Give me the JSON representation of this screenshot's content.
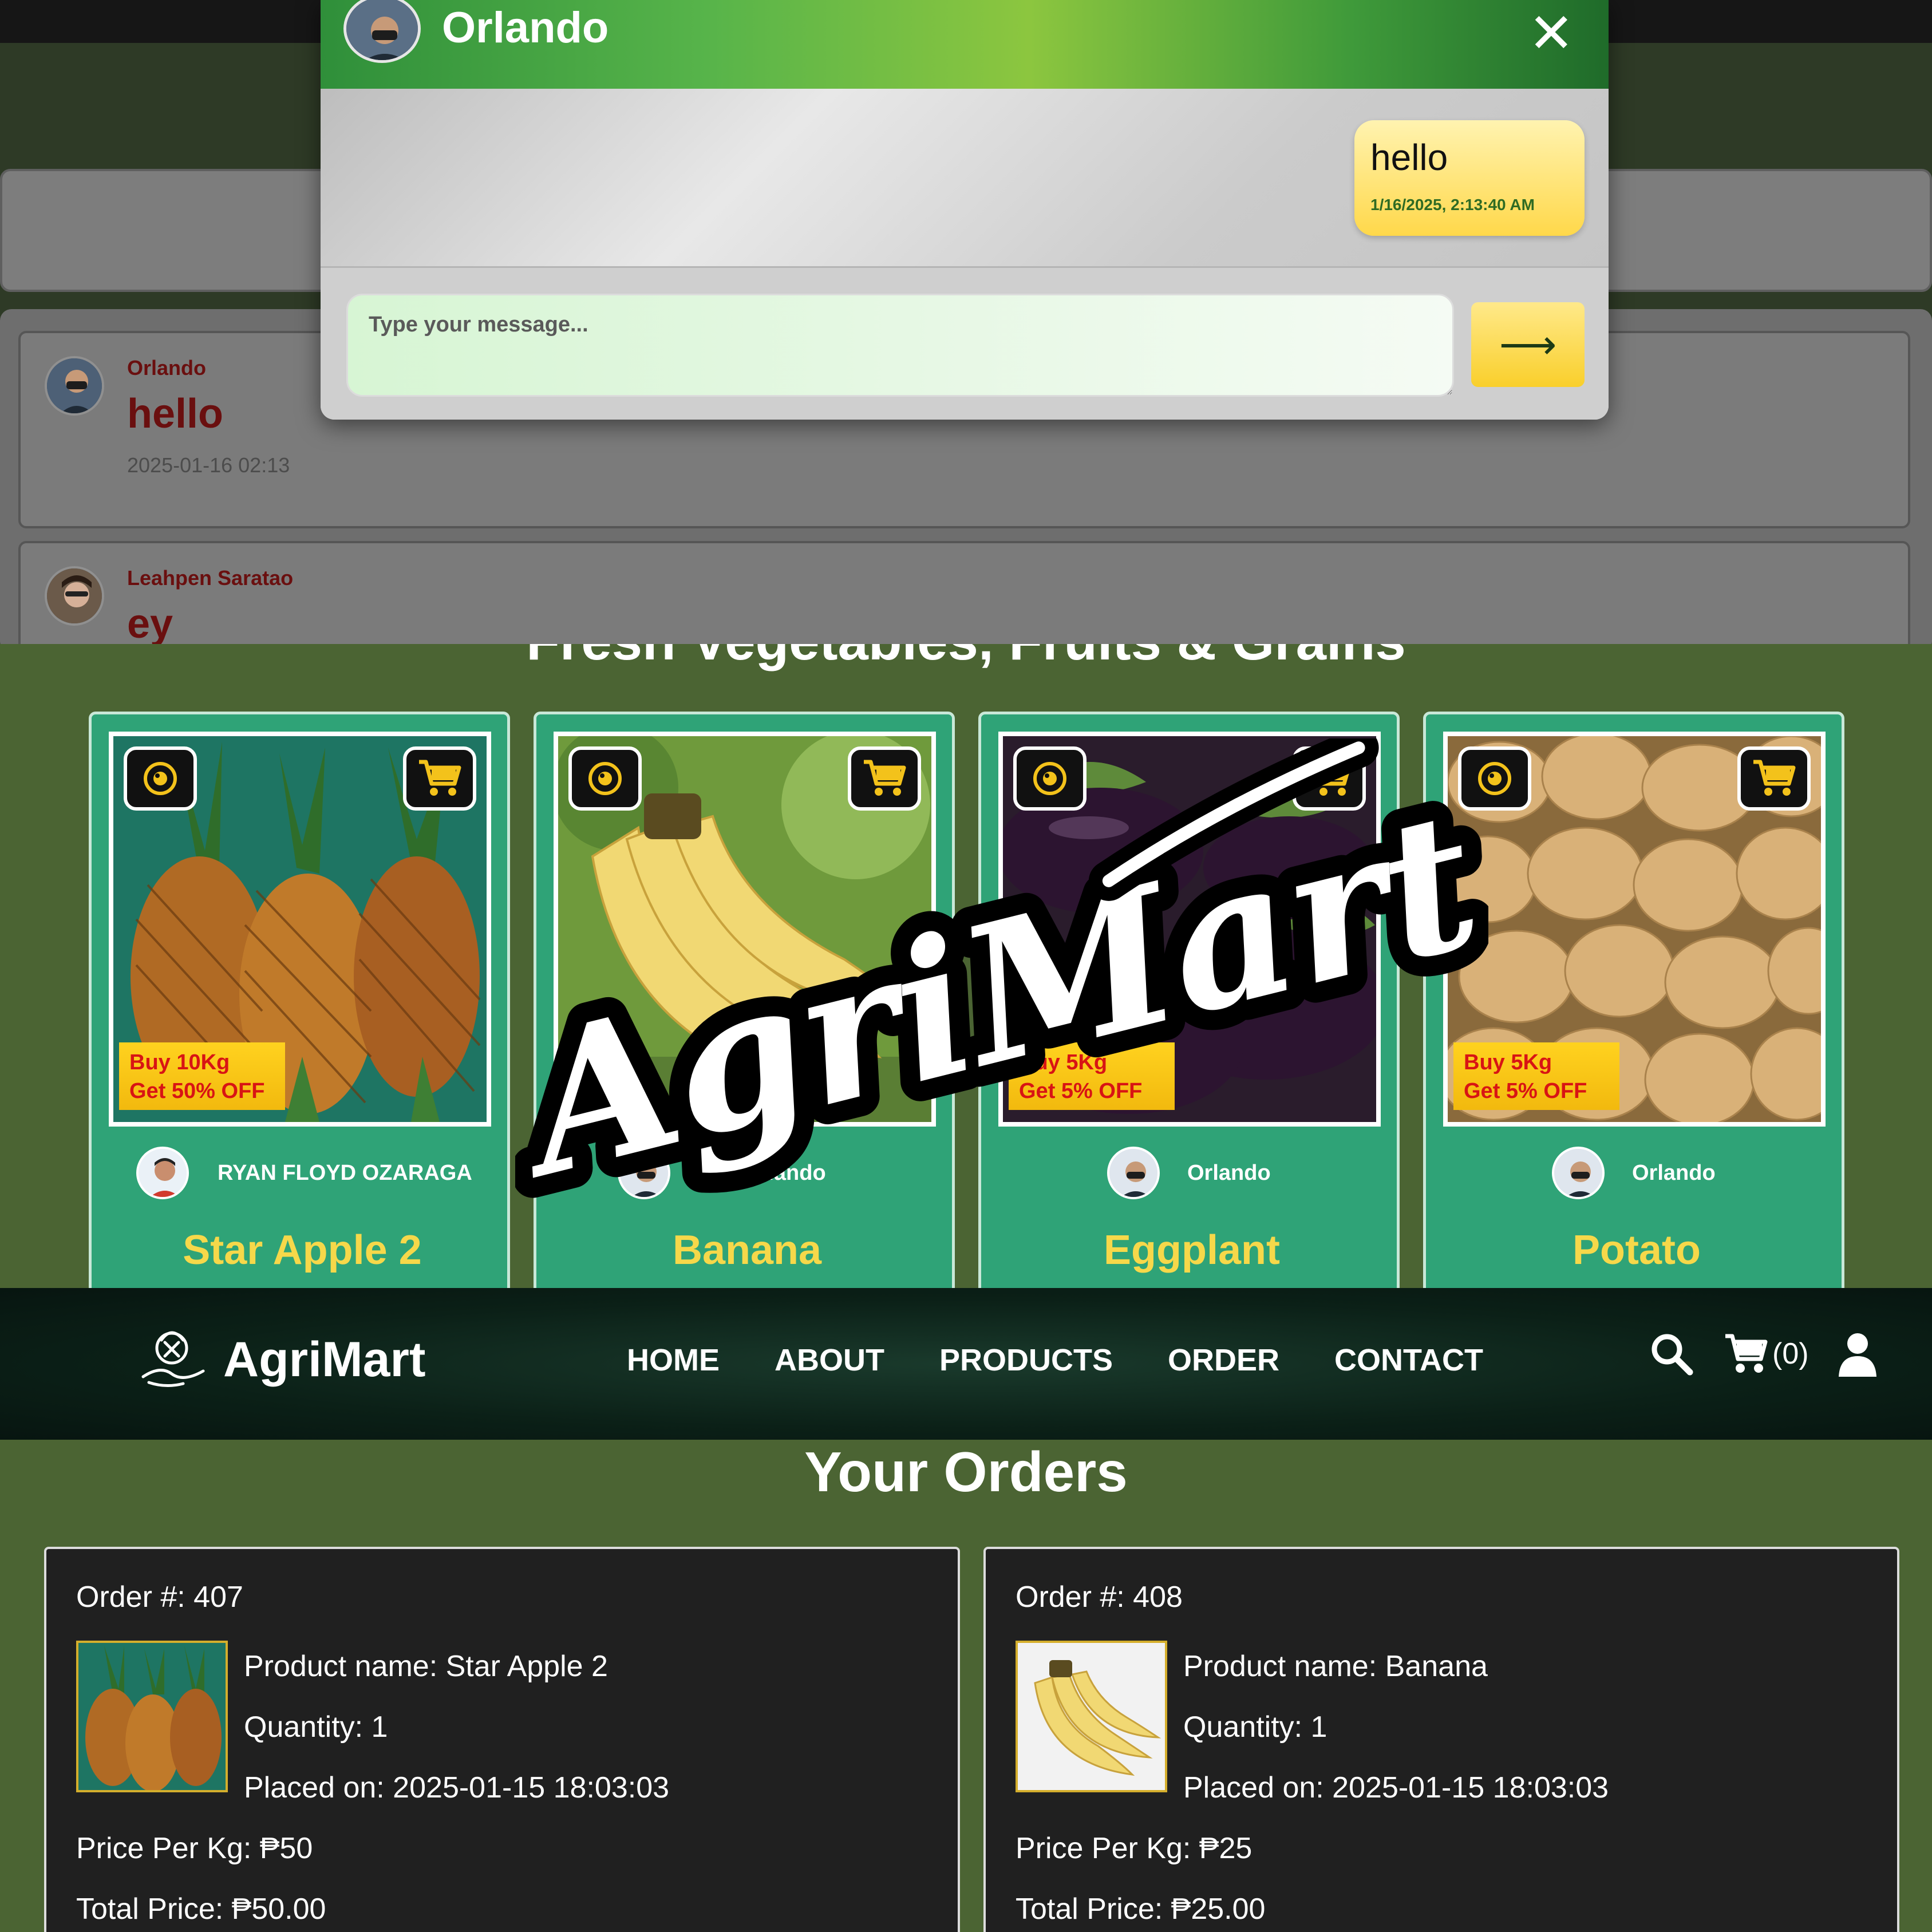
{
  "chat_section": {
    "messages": [
      {
        "sender": "Orlando",
        "text": "hello",
        "time": "2025-01-16 02:13"
      },
      {
        "sender": "Leahpen Saratao",
        "text": "ey"
      }
    ],
    "modal": {
      "contact_name": "Orlando",
      "close_label": "✕",
      "bubble_text": "hello",
      "bubble_time": "1/16/2025, 2:13:40 AM",
      "input_placeholder": "Type your message...",
      "send_label": "⟶"
    }
  },
  "products_section": {
    "title": "Fresh Vegetables, Fruits & Grains",
    "watermark": "AgriMart",
    "products": [
      {
        "name": "Star Apple 2",
        "seller": "RYAN FLOYD OZARAGA",
        "promo_line1": "Buy 10Kg",
        "promo_line2": "Get 50% OFF"
      },
      {
        "name": "Banana",
        "seller": "Orlando"
      },
      {
        "name": "Eggplant",
        "seller": "Orlando",
        "promo_line1": "Buy 5Kg",
        "promo_line2": "Get 5% OFF"
      },
      {
        "name": "Potato",
        "seller": "Orlando",
        "promo_line1": "Buy 5Kg",
        "promo_line2": "Get 5% OFF"
      }
    ]
  },
  "navbar": {
    "brand": "AgriMart",
    "links": [
      "HOME",
      "ABOUT",
      "PRODUCTS",
      "ORDER",
      "CONTACT"
    ],
    "cart_count": "(0)"
  },
  "orders_section": {
    "title": "Your Orders",
    "orders": [
      {
        "order_no": "Order #: 407",
        "product": "Product name: Star Apple 2",
        "quantity": "Quantity: 1",
        "placed": "Placed on: 2025-01-15 18:03:03",
        "price": "Price Per Kg: ₱50",
        "total": "Total Price: ₱50.00"
      },
      {
        "order_no": "Order #: 408",
        "product": "Product name: Banana",
        "quantity": "Quantity: 1",
        "placed": "Placed on: 2025-01-15 18:03:03",
        "price": "Price Per Kg: ₱25",
        "total": "Total Price: ₱25.00"
      }
    ]
  },
  "colors": {
    "accent_green": "#2fa377",
    "badge_yellow": "#ffd21f",
    "product_name_yellow": "#f6d84a",
    "message_text": "#6a0f0f",
    "page_green": "#4b6433"
  }
}
